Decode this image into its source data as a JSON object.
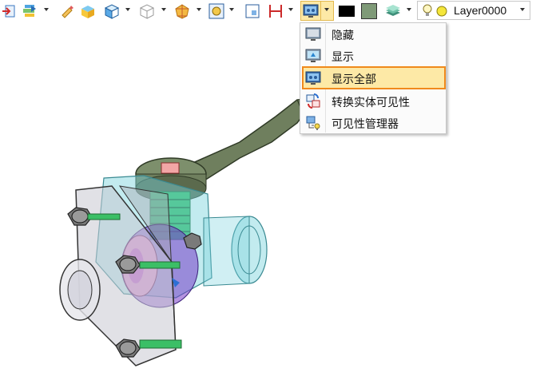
{
  "toolbar": {
    "layer_name": "Layer0000",
    "icons": [
      "import-icon",
      "texture-icon",
      "paint-icon",
      "solid-color-icon",
      "view-cube-icon",
      "wireframe-cube-icon",
      "render-style-icon",
      "zoom-fit-icon",
      "frame-icon",
      "dimension-icon",
      "visibility-icon",
      "black-color-swatch",
      "gray-green-color-swatch",
      "layers-icon",
      "lightbulb-icon",
      "layer-color-icon"
    ],
    "colors": {
      "swatch_black": "#000000",
      "swatch_green": "#7f9a78",
      "accent": "#fde9a6",
      "highlight_border": "#f08a1c"
    }
  },
  "visibility_menu": {
    "items": [
      {
        "label": "隐藏",
        "icon": "hide-monitor-icon"
      },
      {
        "label": "显示",
        "icon": "show-monitor-icon"
      },
      {
        "label": "显示全部",
        "icon": "show-all-monitor-icon",
        "highlighted": true
      },
      {
        "label": "转换实体可见性",
        "icon": "toggle-visibility-icon"
      },
      {
        "label": "可见性管理器",
        "icon": "visibility-manager-icon"
      }
    ]
  },
  "scene": {
    "object": "ball-valve-assembly"
  }
}
